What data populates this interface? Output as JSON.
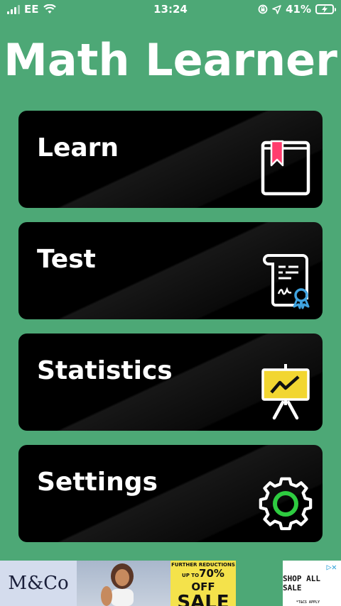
{
  "status_bar": {
    "carrier": "EE",
    "time": "13:24",
    "battery": "41%"
  },
  "app": {
    "title": "Math Learner"
  },
  "menu": [
    {
      "label": "Learn",
      "icon": "book-icon"
    },
    {
      "label": "Test",
      "icon": "certificate-icon"
    },
    {
      "label": "Statistics",
      "icon": "chart-board-icon"
    },
    {
      "label": "Settings",
      "icon": "gear-icon"
    }
  ],
  "ad": {
    "brand": "M&Co",
    "promo_small": "FURTHER REDUCTIONS",
    "promo_up_to": "UP TO",
    "promo_percent": "70% OFF",
    "promo_big": "SALE",
    "terms": "*T&CS APPLY",
    "cta": "SHOP ALL SALE"
  },
  "colors": {
    "background": "#4da876",
    "card": "#000000",
    "bookmark": "#ff3d6e",
    "ribbon": "#3fa3e0",
    "board": "#f2d631",
    "gear_ring": "#2ecc40"
  }
}
